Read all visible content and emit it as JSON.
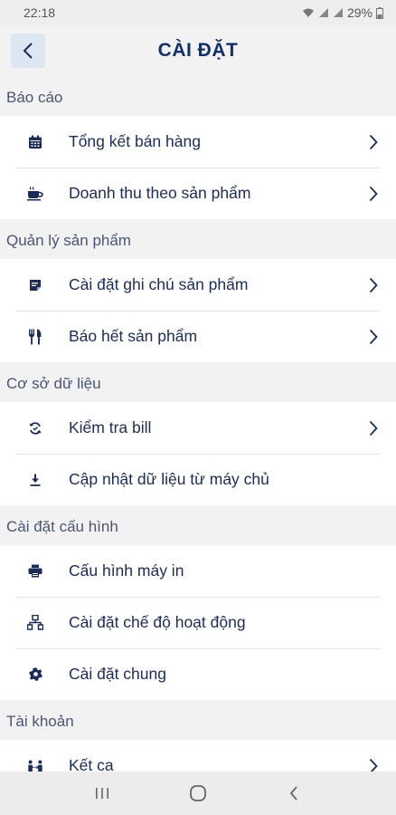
{
  "status": {
    "time": "22:18",
    "battery": "29%"
  },
  "header": {
    "title": "CÀI ĐẶT"
  },
  "sections": [
    {
      "title": "Báo cáo",
      "items": [
        {
          "label": "Tổng kết bán hàng",
          "icon": "calendar-icon",
          "chevron": true
        },
        {
          "label": "Doanh thu theo sản phẩm",
          "icon": "coffee-cup-icon",
          "chevron": true
        }
      ]
    },
    {
      "title": "Quản lý sản phẩm",
      "items": [
        {
          "label": "Cài đặt ghi chú sản phẩm",
          "icon": "note-icon",
          "chevron": true
        },
        {
          "label": "Báo hết sản phẩm",
          "icon": "utensils-icon",
          "chevron": true
        }
      ]
    },
    {
      "title": "Cơ sở dữ liệu",
      "items": [
        {
          "label": "Kiểm tra bill",
          "icon": "sync-icon",
          "chevron": true
        },
        {
          "label": "Cập nhật dữ liệu từ máy chủ",
          "icon": "download-icon",
          "chevron": false
        }
      ]
    },
    {
      "title": "Cài đặt cấu hình",
      "items": [
        {
          "label": "Cấu hình máy in",
          "icon": "printer-icon",
          "chevron": false
        },
        {
          "label": "Cài đặt chế độ hoạt động",
          "icon": "network-icon",
          "chevron": false
        },
        {
          "label": "Cài đặt chung",
          "icon": "gear-icon",
          "chevron": false
        }
      ]
    },
    {
      "title": "Tài khoản",
      "items": [
        {
          "label": "Kết ca",
          "icon": "shift-handover-icon",
          "chevron": true
        }
      ]
    }
  ]
}
